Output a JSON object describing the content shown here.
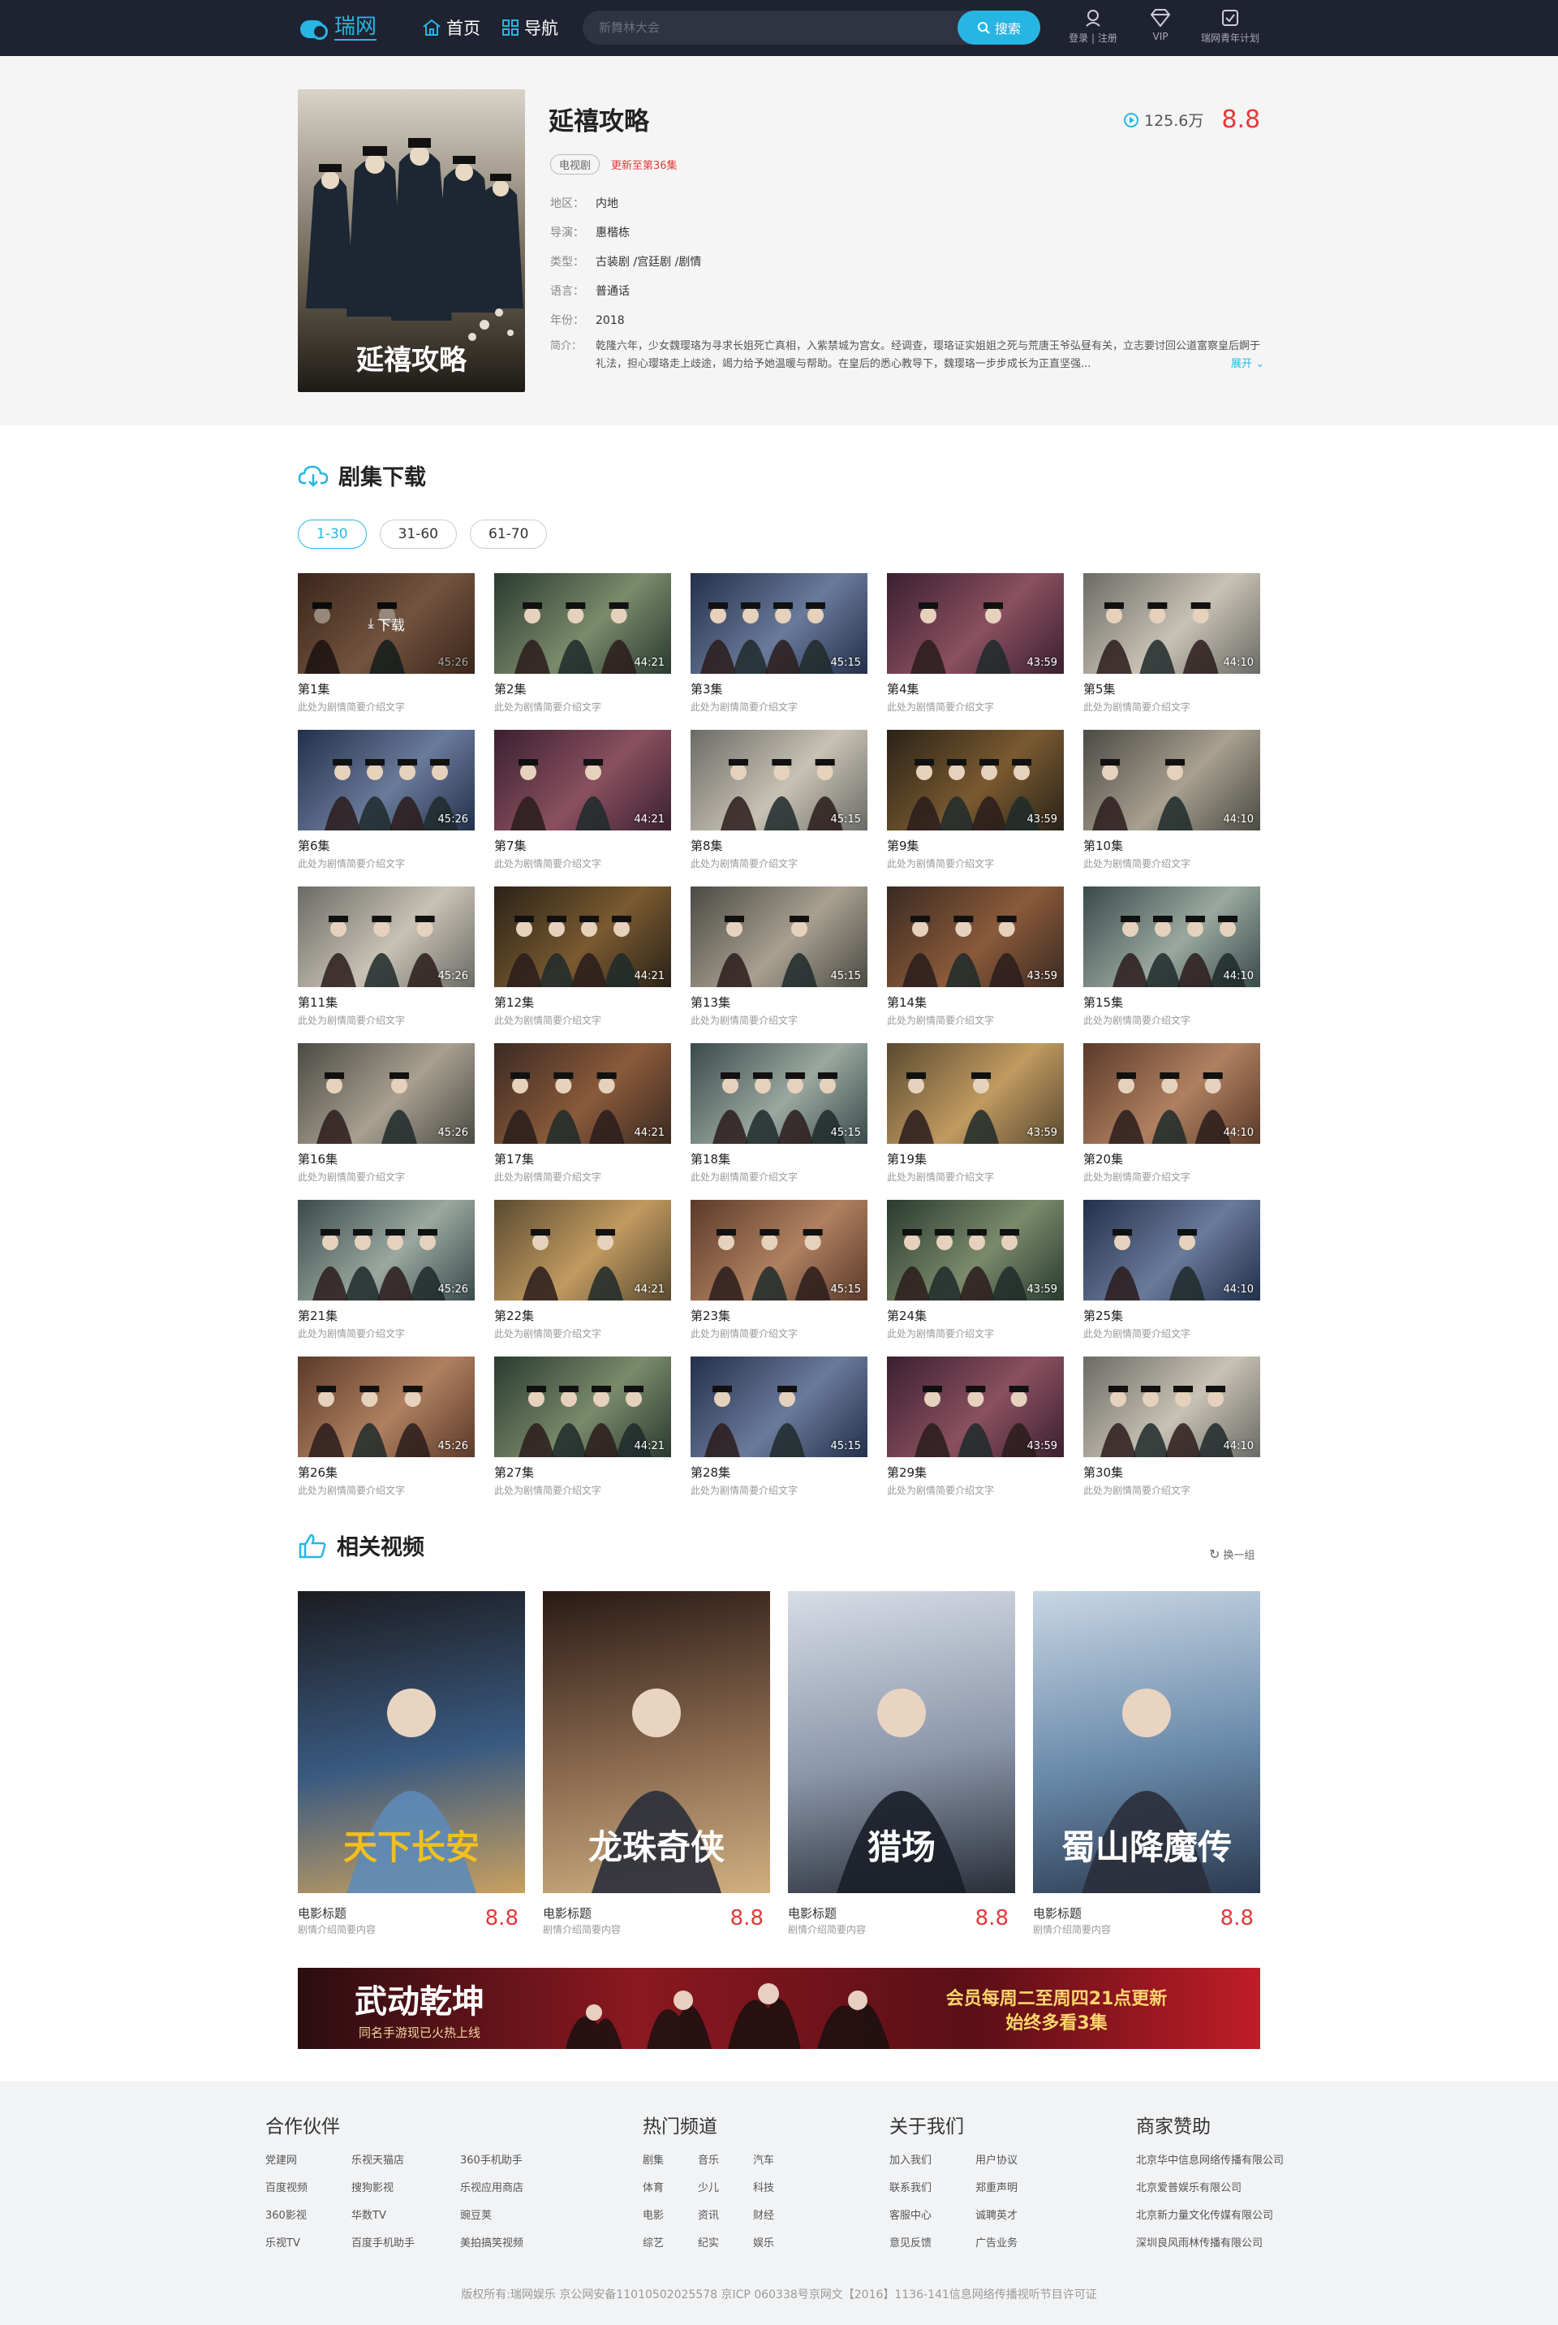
{
  "header": {
    "logo_text": "瑞网",
    "nav_home": "首页",
    "nav_guide": "导航",
    "search_placeholder": "新舞林大会",
    "search_button": "搜索",
    "login": "登录",
    "register": "注册",
    "vip": "VIP",
    "youth_plan": "瑞网青年计划"
  },
  "detail": {
    "title": "延禧攻略",
    "poster_title": "延禧攻略",
    "play_count": "125.6万",
    "score": "8.8",
    "tag": "电视剧",
    "update": "更新至第36集",
    "area_label": "地区：",
    "area": "内地",
    "director_label": "导演：",
    "director": "惠楷栋",
    "genre_label": "类型：",
    "genre": "古装剧 /宫廷剧 /剧情",
    "language_label": "语言：",
    "language": "普通话",
    "year_label": "年份：",
    "year": "2018",
    "desc_label": "简介：",
    "desc": "乾隆六年，少女魏璎珞为寻求长姐死亡真相，入紫禁城为宫女。经调查，璎珞证实姐姐之死与荒唐王爷弘昼有关，立志要讨回公道富察皇后婀于礼法，担心璎珞走上歧途，竭力给予她温暖与帮助。在皇后的悉心教导下，魏璎珞一步步成长为正直坚强...",
    "expand": "展开"
  },
  "episodes_section": {
    "title": "剧集下载",
    "ranges": [
      "1-30",
      "31-60",
      "61-70"
    ],
    "download_label": "下载",
    "items": [
      {
        "name": "第1集",
        "sub": "此处为剧情简要介绍文字",
        "dur": "45:26"
      },
      {
        "name": "第2集",
        "sub": "此处为剧情简要介绍文字",
        "dur": "44:21"
      },
      {
        "name": "第3集",
        "sub": "此处为剧情简要介绍文字",
        "dur": "45:15"
      },
      {
        "name": "第4集",
        "sub": "此处为剧情简要介绍文字",
        "dur": "43:59"
      },
      {
        "name": "第5集",
        "sub": "此处为剧情简要介绍文字",
        "dur": "44:10"
      },
      {
        "name": "第6集",
        "sub": "此处为剧情简要介绍文字",
        "dur": "45:26"
      },
      {
        "name": "第7集",
        "sub": "此处为剧情简要介绍文字",
        "dur": "44:21"
      },
      {
        "name": "第8集",
        "sub": "此处为剧情简要介绍文字",
        "dur": "45:15"
      },
      {
        "name": "第9集",
        "sub": "此处为剧情简要介绍文字",
        "dur": "43:59"
      },
      {
        "name": "第10集",
        "sub": "此处为剧情简要介绍文字",
        "dur": "44:10"
      },
      {
        "name": "第11集",
        "sub": "此处为剧情简要介绍文字",
        "dur": "45:26"
      },
      {
        "name": "第12集",
        "sub": "此处为剧情简要介绍文字",
        "dur": "44:21"
      },
      {
        "name": "第13集",
        "sub": "此处为剧情简要介绍文字",
        "dur": "45:15"
      },
      {
        "name": "第14集",
        "sub": "此处为剧情简要介绍文字",
        "dur": "43:59"
      },
      {
        "name": "第15集",
        "sub": "此处为剧情简要介绍文字",
        "dur": "44:10"
      },
      {
        "name": "第16集",
        "sub": "此处为剧情简要介绍文字",
        "dur": "45:26"
      },
      {
        "name": "第17集",
        "sub": "此处为剧情简要介绍文字",
        "dur": "44:21"
      },
      {
        "name": "第18集",
        "sub": "此处为剧情简要介绍文字",
        "dur": "45:15"
      },
      {
        "name": "第19集",
        "sub": "此处为剧情简要介绍文字",
        "dur": "43:59"
      },
      {
        "name": "第20集",
        "sub": "此处为剧情简要介绍文字",
        "dur": "44:10"
      },
      {
        "name": "第21集",
        "sub": "此处为剧情简要介绍文字",
        "dur": "45:26"
      },
      {
        "name": "第22集",
        "sub": "此处为剧情简要介绍文字",
        "dur": "44:21"
      },
      {
        "name": "第23集",
        "sub": "此处为剧情简要介绍文字",
        "dur": "45:15"
      },
      {
        "name": "第24集",
        "sub": "此处为剧情简要介绍文字",
        "dur": "43:59"
      },
      {
        "name": "第25集",
        "sub": "此处为剧情简要介绍文字",
        "dur": "44:10"
      },
      {
        "name": "第26集",
        "sub": "此处为剧情简要介绍文字",
        "dur": "45:26"
      },
      {
        "name": "第27集",
        "sub": "此处为剧情简要介绍文字",
        "dur": "44:21"
      },
      {
        "name": "第28集",
        "sub": "此处为剧情简要介绍文字",
        "dur": "45:15"
      },
      {
        "name": "第29集",
        "sub": "此处为剧情简要介绍文字",
        "dur": "43:59"
      },
      {
        "name": "第30集",
        "sub": "此处为剧情简要介绍文字",
        "dur": "44:10"
      }
    ]
  },
  "related": {
    "title": "相关视频",
    "refresh": "换一组",
    "items": [
      {
        "name": "电影标题",
        "sub": "剧情介绍简要内容",
        "score": "8.8",
        "poster_text": "天下长安"
      },
      {
        "name": "电影标题",
        "sub": "剧情介绍简要内容",
        "score": "8.8",
        "poster_text": "龙珠奇侠"
      },
      {
        "name": "电影标题",
        "sub": "剧情介绍简要内容",
        "score": "8.8",
        "poster_text": "猎场"
      },
      {
        "name": "电影标题",
        "sub": "剧情介绍简要内容",
        "score": "8.8",
        "poster_text": "蜀山降魔传"
      }
    ]
  },
  "banner": {
    "left": "武动乾坤",
    "left_sub": "同名手游现已火热上线",
    "right_line1": "会员每周二至周四21点更新",
    "right_line2": "始终多看3集"
  },
  "footer": {
    "partners_title": "合作伙伴",
    "partners": [
      "党建网",
      "乐视天猫店",
      "360手机助手",
      "百度视频",
      "搜狗影视",
      "乐视应用商店",
      "360影视",
      "华数TV",
      "豌豆荚",
      "乐视TV",
      "百度手机助手",
      "美拍搞笑视频"
    ],
    "channels_title": "热门频道",
    "channels": [
      "剧集",
      "音乐",
      "汽车",
      "体育",
      "少儿",
      "科技",
      "电影",
      "资讯",
      "财经",
      "综艺",
      "纪实",
      "娱乐"
    ],
    "about_title": "关于我们",
    "about": [
      "加入我们",
      "用户协议",
      "联系我们",
      "郑重声明",
      "客服中心",
      "诚聘英才",
      "意见反馈",
      "广告业务"
    ],
    "sponsor_title": "商家赞助",
    "sponsors": [
      "北京华中信息网络传播有限公司",
      "北京爱普娱乐有限公司",
      "北京新力量文化传媒有限公司",
      "深圳良风雨林传播有限公司"
    ],
    "copyright": "版权所有:瑞网娱乐  京公网安备11010502025578   京ICP 060338号京网文【2016】1136-141信息网络传播视听节目许可证"
  },
  "colors": {
    "accent": "#27b6e4",
    "score": "#e23a3a",
    "topbar": "#1f2230"
  }
}
